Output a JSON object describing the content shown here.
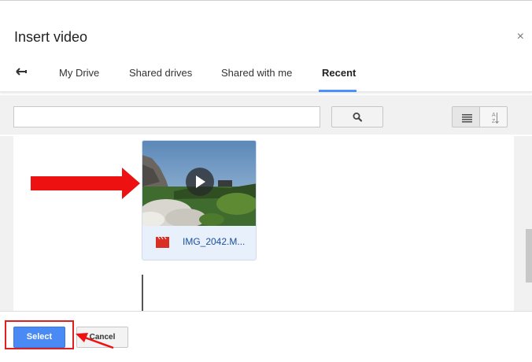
{
  "dialog": {
    "title": "Insert video",
    "close_glyph": "×"
  },
  "tabs": {
    "back_icon": "back-arrow-icon",
    "items": [
      {
        "label": "My Drive"
      },
      {
        "label": "Shared drives"
      },
      {
        "label": "Shared with me"
      },
      {
        "label": "Recent",
        "active": true
      }
    ],
    "accent_color": "#4d90fe"
  },
  "toolbar": {
    "search_placeholder": "",
    "search_icon": "search-icon",
    "list_view_icon": "list-view-icon",
    "sort_icon": "sort-az-icon"
  },
  "files": [
    {
      "name": "IMG_2042.M...",
      "type_icon": "video-file-icon",
      "selected": true
    }
  ],
  "footer": {
    "select_label": "Select",
    "cancel_label": "Cancel",
    "select_color": "#4a8af4"
  },
  "annotations": {
    "color": "#e02020"
  }
}
